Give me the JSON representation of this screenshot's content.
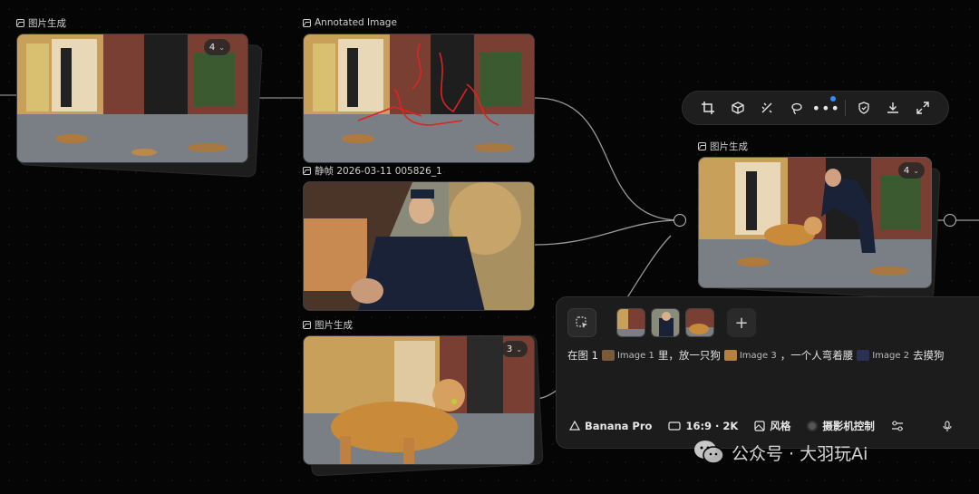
{
  "nodes": [
    {
      "id": "n1",
      "label": "图片生成",
      "badge": "4"
    },
    {
      "id": "n2",
      "label": "Annotated Image"
    },
    {
      "id": "n3",
      "label": "静帧 2026-03-11 005826_1"
    },
    {
      "id": "n4",
      "label": "图片生成",
      "badge": "3"
    },
    {
      "id": "n5",
      "label": "图片生成",
      "badge": "4"
    }
  ],
  "toolbar": {
    "icons": [
      "crop-icon",
      "cube-icon",
      "magic-eraser-icon",
      "lasso-icon",
      "more-icon",
      "shield-icon",
      "download-icon",
      "expand-icon"
    ]
  },
  "prompt": {
    "segments": {
      "s1": "在图 1",
      "ref1": "Image 1",
      "s2": "里，放一只狗",
      "ref2": "Image 3",
      "s3": "，一个人弯着腰",
      "ref3": "Image 2",
      "s4": "去摸狗"
    },
    "model": "Banana Pro",
    "aspect": "16:9 · 2K",
    "style": "风格",
    "camera": "摄影机控制"
  },
  "watermark": {
    "text": "公众号 · 大羽玩Ai"
  },
  "colors": {
    "annotation_red": "#e0231f",
    "accent_blue": "#2a8cff"
  }
}
